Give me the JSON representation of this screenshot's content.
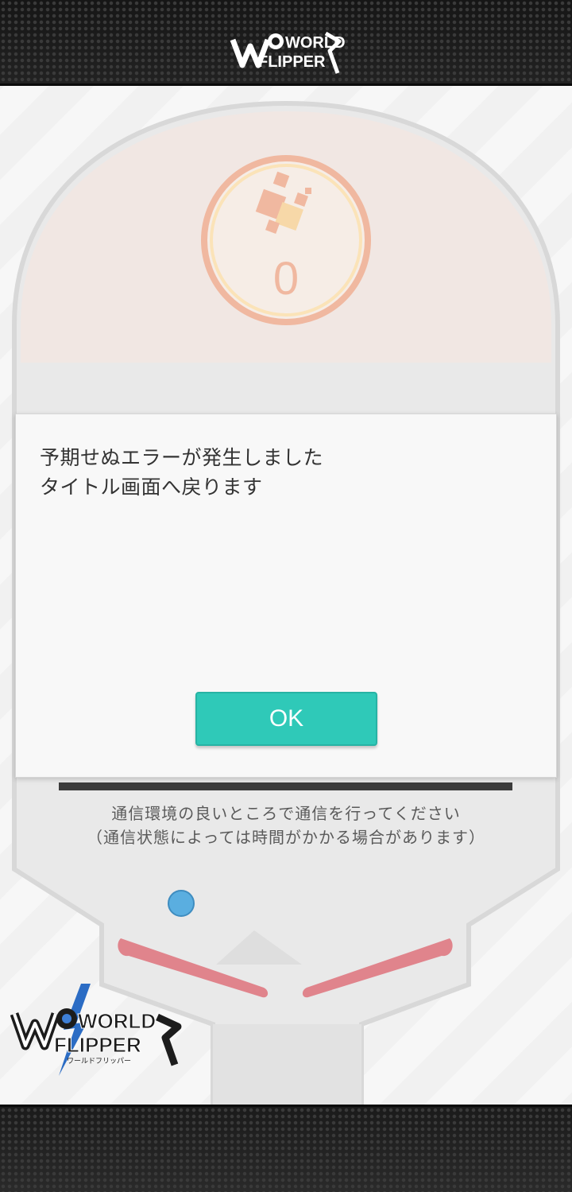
{
  "header": {
    "logo_text_top": "WORLD",
    "logo_text_bottom": "FLIPPER"
  },
  "board": {
    "counter_value": "0"
  },
  "dialog": {
    "message_line1": "予期せぬエラーが発生しました",
    "message_line2": "タイトル画面へ戻ります",
    "ok_label": "OK"
  },
  "loading": {
    "notice_line1": "通信環境の良いところで通信を行ってください",
    "notice_line2": "（通信状態によっては時間がかかる場合があります）",
    "progress": 1.0
  },
  "footer_logo": {
    "text_top": "WORLD",
    "text_bottom": "FLIPPER",
    "subtitle": "ワールドフリッパー"
  },
  "colors": {
    "accent": "#2fc9b8",
    "flipper": "#e0848c",
    "ball": "#5aaee0",
    "counter_ring": "#f0b8a0"
  }
}
